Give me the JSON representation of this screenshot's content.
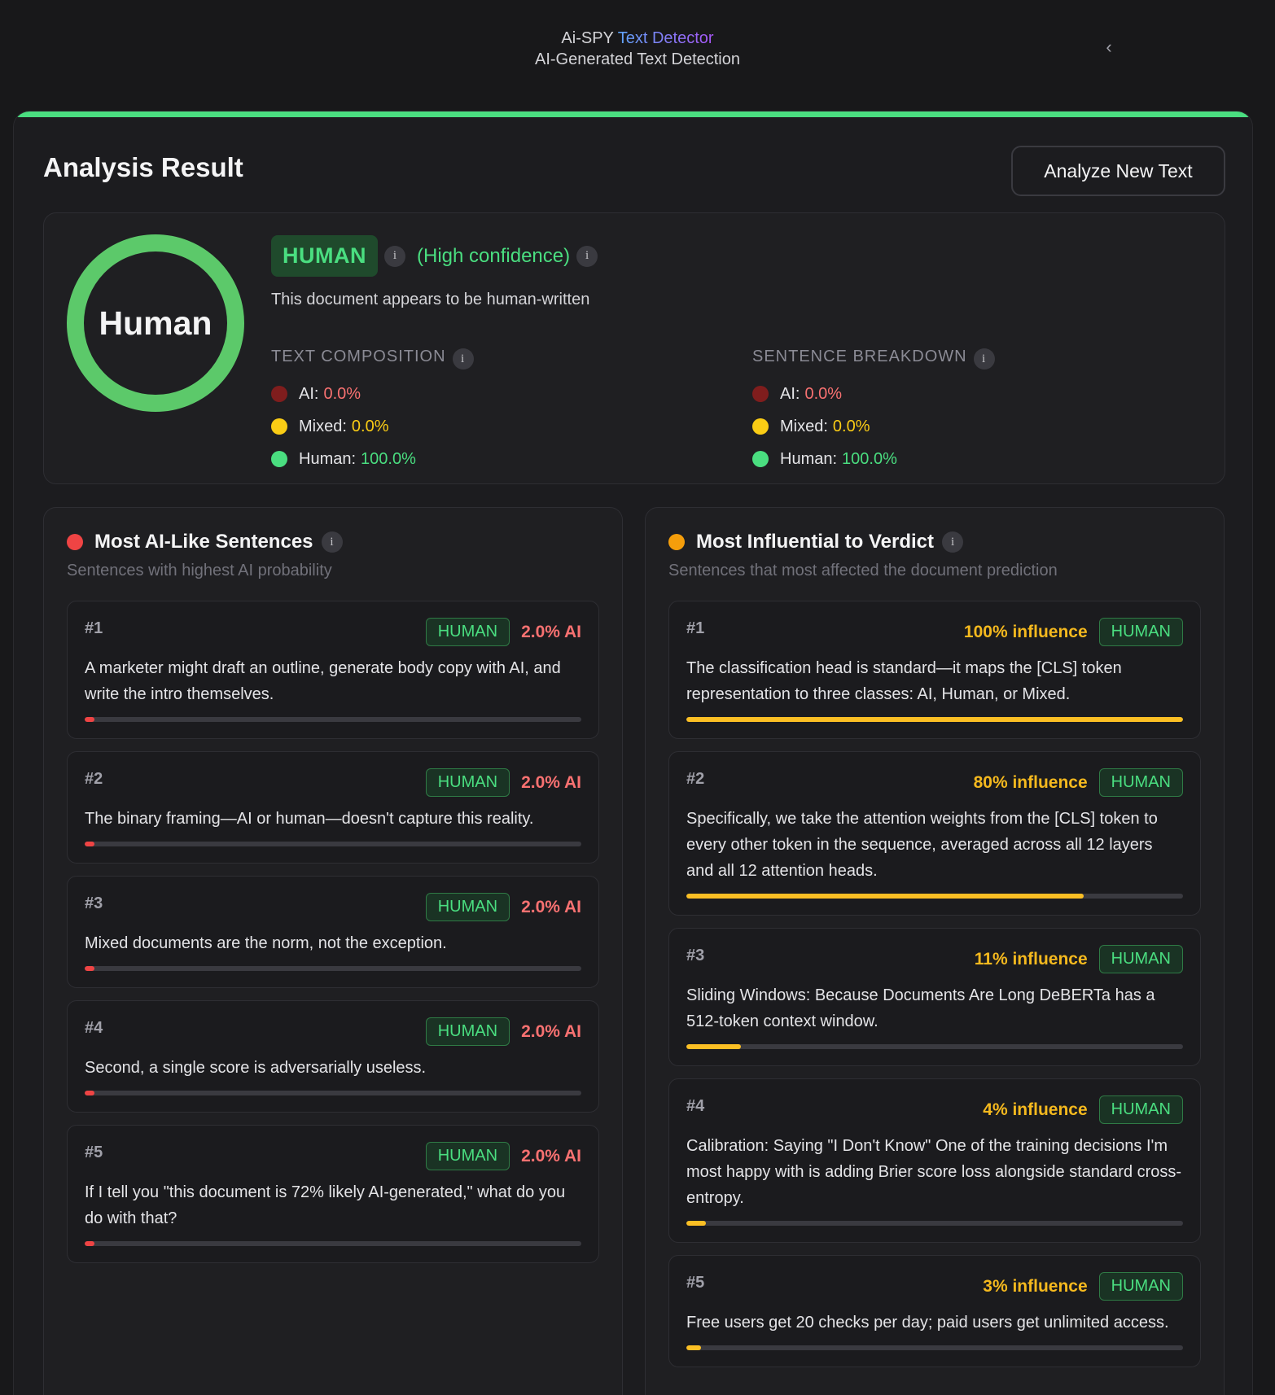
{
  "header": {
    "brand_prefix": "Ai-SPY",
    "brand_accent": "Text Detector",
    "subtitle": "AI-Generated Text Detection",
    "collapse_icon": "chevron-left-icon"
  },
  "result": {
    "title": "Analysis Result",
    "new_button": "Analyze New Text",
    "ring_label": "Human",
    "verdict": "HUMAN",
    "confidence": "(High confidence)",
    "description": "This document appears to be human-written",
    "info_glyph": "i",
    "colors": {
      "ai": "#f87171",
      "mixed": "#facc15",
      "human": "#4ade80",
      "accent_bar": "#4ade80"
    }
  },
  "composition": {
    "heading": "TEXT COMPOSITION",
    "ai_label": "AI:",
    "ai_value": "0.0%",
    "mixed_label": "Mixed:",
    "mixed_value": "0.0%",
    "human_label": "Human:",
    "human_value": "100.0%"
  },
  "breakdown": {
    "heading": "SENTENCE BREAKDOWN",
    "ai_label": "AI:",
    "ai_value": "0.0%",
    "mixed_label": "Mixed:",
    "mixed_value": "0.0%",
    "human_label": "Human:",
    "human_value": "100.0%"
  },
  "ai_like": {
    "title": "Most AI-Like Sentences",
    "subtitle": "Sentences with highest AI probability",
    "items": [
      {
        "rank": "#1",
        "badge": "HUMAN",
        "score": "2.0% AI",
        "fraction": 0.02,
        "text": "A marketer might draft an outline, generate body copy with AI, and write the intro themselves."
      },
      {
        "rank": "#2",
        "badge": "HUMAN",
        "score": "2.0% AI",
        "fraction": 0.02,
        "text": "The binary framing—AI or human—doesn't capture this reality."
      },
      {
        "rank": "#3",
        "badge": "HUMAN",
        "score": "2.0% AI",
        "fraction": 0.02,
        "text": "Mixed documents are the norm, not the exception."
      },
      {
        "rank": "#4",
        "badge": "HUMAN",
        "score": "2.0% AI",
        "fraction": 0.02,
        "text": "Second, a single score is adversarially useless."
      },
      {
        "rank": "#5",
        "badge": "HUMAN",
        "score": "2.0% AI",
        "fraction": 0.02,
        "text": "If I tell you \"this document is 72% likely AI-generated,\" what do you do with that?"
      }
    ]
  },
  "influential": {
    "title": "Most Influential to Verdict",
    "subtitle": "Sentences that most affected the document prediction",
    "items": [
      {
        "rank": "#1",
        "badge": "HUMAN",
        "score": "100% influence",
        "fraction": 1.0,
        "text": "The classification head is standard—it maps the [CLS] token representation to three classes: AI, Human, or Mixed."
      },
      {
        "rank": "#2",
        "badge": "HUMAN",
        "score": "80% influence",
        "fraction": 0.8,
        "text": "Specifically, we take the attention weights from the [CLS] token to every other token in the sequence, averaged across all 12 layers and all 12 attention heads."
      },
      {
        "rank": "#3",
        "badge": "HUMAN",
        "score": "11% influence",
        "fraction": 0.11,
        "text": "Sliding Windows: Because Documents Are Long DeBERTa has a 512-token context window."
      },
      {
        "rank": "#4",
        "badge": "HUMAN",
        "score": "4% influence",
        "fraction": 0.04,
        "text": "Calibration: Saying \"I Don't Know\" One of the training decisions I'm most happy with is adding Brier score loss alongside standard cross-entropy."
      },
      {
        "rank": "#5",
        "badge": "HUMAN",
        "score": "3% influence",
        "fraction": 0.03,
        "text": "Free users get 20 checks per day; paid users get unlimited access."
      }
    ]
  }
}
